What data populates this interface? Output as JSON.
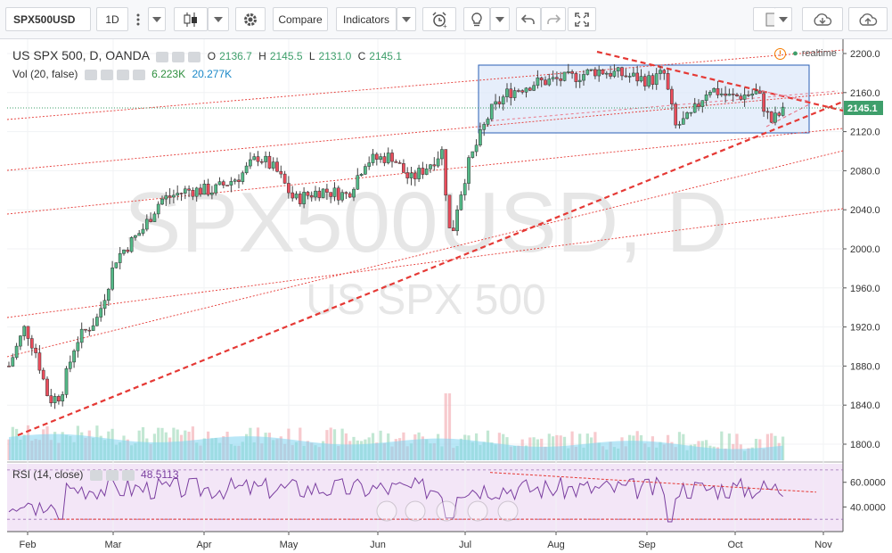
{
  "toolbar": {
    "symbol": "SPX500USD",
    "interval": "1D",
    "compare_label": "Compare",
    "indicators_label": "Indicators"
  },
  "legend": {
    "title": "US SPX 500, D, OANDA",
    "o_label": "O",
    "o_value": "2136.7",
    "h_label": "H",
    "h_value": "2145.5",
    "l_label": "L",
    "l_value": "2131.0",
    "c_label": "C",
    "c_value": "2145.1",
    "vol_label": "Vol (20, false)",
    "vol_value1": "6.223K",
    "vol_value2": "20.277K",
    "realtime": "realtime"
  },
  "watermark": {
    "symbol": "SPX500USD, D",
    "name": "US SPX 500"
  },
  "price_axis": {
    "ticks": [
      "2200.0",
      "2160.0",
      "2120.0",
      "2080.0",
      "2040.0",
      "2000.0",
      "1960.0",
      "1920.0",
      "1880.0",
      "1840.0",
      "1800.0"
    ],
    "current": "2145.1"
  },
  "rsi": {
    "label": "RSI (14, close)",
    "value": "48.5113",
    "ticks": [
      "60.0000",
      "40.0000"
    ]
  },
  "time_axis": {
    "labels": [
      "Feb",
      "Mar",
      "Apr",
      "May",
      "Jun",
      "Jul",
      "Aug",
      "Sep",
      "Oct",
      "Nov"
    ]
  },
  "colors": {
    "up": "#53b987",
    "down": "#eb4d5c",
    "volume": "#7fd3f0",
    "trend": "#e53935",
    "rsi_bg": "#f3e6f7",
    "rsi_line": "#7b3fa0",
    "box_fill": "#dde8fa",
    "price_badge": "#3e9f6b"
  },
  "icons": {
    "indicators_menu": "indicators-dropdown-icon",
    "bar_style": "candles-icon",
    "settings": "gear-icon",
    "alert": "alarm-clock-icon",
    "idea": "lightbulb-icon",
    "undo": "undo-icon",
    "redo": "redo-icon",
    "fullscreen": "fullscreen-icon",
    "cloud_load": "cloud-download-icon",
    "cloud_save": "cloud-upload-icon"
  },
  "chart_data": {
    "type": "candlestick",
    "symbol": "US SPX 500",
    "interval": "D",
    "ylim": [
      1780,
      2205
    ],
    "rsi_ylim": [
      20,
      75
    ],
    "x_labels": [
      "Feb",
      "Mar",
      "Apr",
      "May",
      "Jun",
      "Jul",
      "Aug",
      "Sep",
      "Oct",
      "Nov"
    ],
    "ohlc": {
      "open": 2136.7,
      "high": 2145.5,
      "low": 2131.0,
      "close": 2145.1
    },
    "volume_ma20": 20.277,
    "volume_last": 6.223,
    "rsi_last": 48.5113
  }
}
